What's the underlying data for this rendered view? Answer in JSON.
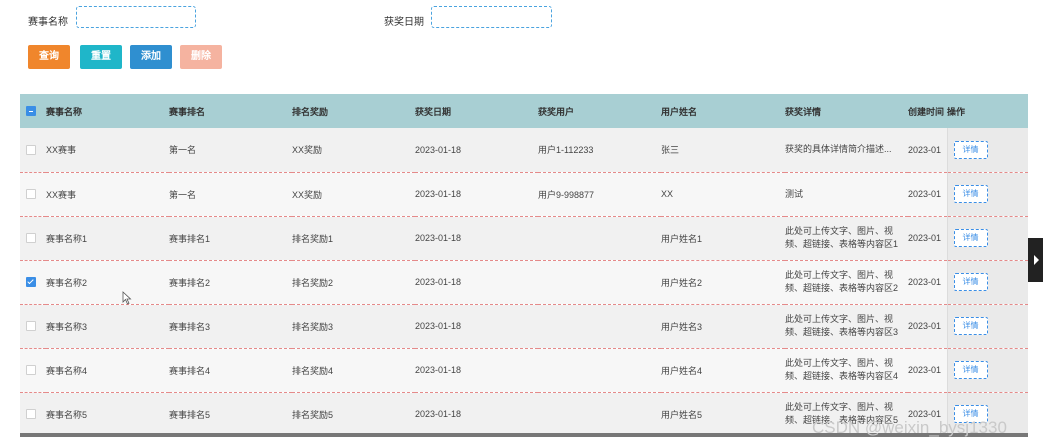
{
  "search": {
    "name_label": "赛事名称",
    "name_value": "",
    "date_label": "获奖日期",
    "date_value": ""
  },
  "buttons": {
    "query": "查询",
    "reset": "重置",
    "add": "添加",
    "delete": "删除"
  },
  "colors": {
    "query": "#f0862c",
    "reset": "#1fb6c9",
    "add": "#2f8fd0",
    "delete": "#f5b3a0",
    "header": "#a8cfd3",
    "accent": "#3a8ee6"
  },
  "table": {
    "columns": [
      "赛事名称",
      "赛事排名",
      "排名奖励",
      "获奖日期",
      "获奖用户",
      "用户姓名",
      "获奖详情",
      "创建时间",
      "操作"
    ],
    "detail_button": "详情",
    "rows": [
      {
        "checked": false,
        "name": "XX赛事",
        "rank": "第一名",
        "reward": "XX奖励",
        "date": "2023-01-18",
        "user": "用户1-112233",
        "username": "张三",
        "detail": "获奖的具体详情简介描述...",
        "created": "2023-01"
      },
      {
        "checked": false,
        "name": "XX赛事",
        "rank": "第一名",
        "reward": "XX奖励",
        "date": "2023-01-18",
        "user": "用户9-998877",
        "username": "XX",
        "detail": "测试",
        "created": "2023-01"
      },
      {
        "checked": false,
        "name": "赛事名称1",
        "rank": "赛事排名1",
        "reward": "排名奖励1",
        "date": "2023-01-18",
        "user": "",
        "username": "用户姓名1",
        "detail": "此处可上传文字、图片、视频、超链接、表格等内容区1",
        "created": "2023-01"
      },
      {
        "checked": true,
        "name": "赛事名称2",
        "rank": "赛事排名2",
        "reward": "排名奖励2",
        "date": "2023-01-18",
        "user": "",
        "username": "用户姓名2",
        "detail": "此处可上传文字、图片、视频、超链接、表格等内容区2",
        "created": "2023-01"
      },
      {
        "checked": false,
        "name": "赛事名称3",
        "rank": "赛事排名3",
        "reward": "排名奖励3",
        "date": "2023-01-18",
        "user": "",
        "username": "用户姓名3",
        "detail": "此处可上传文字、图片、视频、超链接、表格等内容区3",
        "created": "2023-01"
      },
      {
        "checked": false,
        "name": "赛事名称4",
        "rank": "赛事排名4",
        "reward": "排名奖励4",
        "date": "2023-01-18",
        "user": "",
        "username": "用户姓名4",
        "detail": "此处可上传文字、图片、视频、超链接、表格等内容区4",
        "created": "2023-01"
      },
      {
        "checked": false,
        "name": "赛事名称5",
        "rank": "赛事排名5",
        "reward": "排名奖励5",
        "date": "2023-01-18",
        "user": "",
        "username": "用户姓名5",
        "detail": "此处可上传文字、图片、视频、超链接、表格等内容区5",
        "created": "2023-01"
      }
    ]
  },
  "watermark": "CSDN @weixin_bysj1330"
}
